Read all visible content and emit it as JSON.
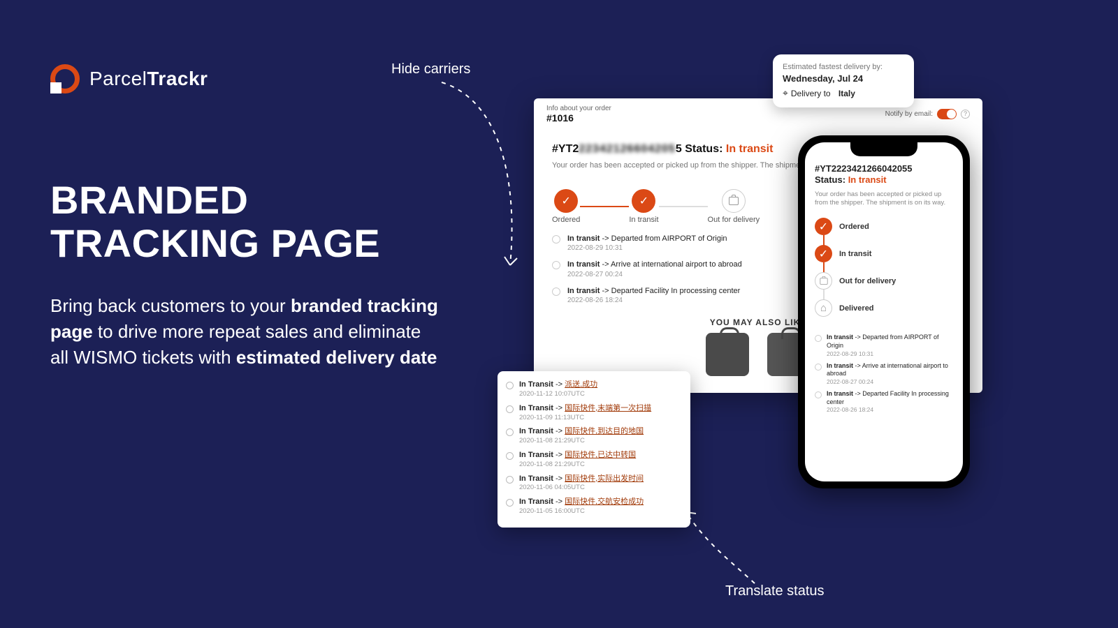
{
  "logo": {
    "name": "ParcelTrackr"
  },
  "headline": {
    "line1": "BRANDED",
    "line2": "TRACKING PAGE"
  },
  "sub": {
    "p1": "Bring back customers to your",
    "b1": "branded tracking page",
    "p2": "to drive more repeat sales and eliminate all WISMO tickets with",
    "b2": "estimated delivery date"
  },
  "annotations": {
    "hide": "Hide carriers",
    "translate": "Translate status"
  },
  "est": {
    "label": "Estimated fastest delivery by:",
    "date": "Wednesday, Jul 24",
    "deliv_prefix": "Delivery to",
    "deliv_country": "Italy"
  },
  "browser": {
    "info_label": "Info about your order",
    "order_no": "#1016",
    "notify_label": "Notify by email:",
    "tracking_prefix": "#YT2",
    "tracking_blur": "22342126604205",
    "tracking_suffix": "5",
    "status_label": "Status:",
    "status_value": "In transit",
    "sub_status": "Your order has been accepted or picked up from the shipper. The shipment is on its way.",
    "steps": [
      "Ordered",
      "In transit",
      "Out for delivery"
    ],
    "events": [
      {
        "status": "In transit",
        "desc": "Departed from AIRPORT of Origin",
        "date": "2022-08-29 10:31"
      },
      {
        "status": "In transit",
        "desc": "Arrive at international airport to abroad",
        "date": "2022-08-27 00:24"
      },
      {
        "status": "In transit",
        "desc": "Departed Facility In processing center",
        "date": "2022-08-26 18:24"
      }
    ],
    "like_heading": "YOU MAY ALSO LIKE"
  },
  "inset": {
    "events": [
      {
        "s": "In Transit",
        "cn": "派送,成功",
        "d": "2020-11-12 10:07UTC"
      },
      {
        "s": "In Transit",
        "cn": "国际快件,末端第一次扫描",
        "d": "2020-11-09 11:13UTC"
      },
      {
        "s": "In Transit",
        "cn": "国际快件,到达目的地国",
        "d": "2020-11-08 21:29UTC"
      },
      {
        "s": "In Transit",
        "cn": "国际快件,已达中转国",
        "d": "2020-11-08 21:29UTC"
      },
      {
        "s": "In Transit",
        "cn": "国际快件,实际出发时间",
        "d": "2020-11-06 04:05UTC"
      },
      {
        "s": "In Transit",
        "cn": "国际快件,交航安检成功",
        "d": "2020-11-05 16:00UTC"
      }
    ]
  },
  "phone": {
    "tracking": "#YT2223421266042055",
    "status_label": "Status:",
    "status_value": "In transit",
    "sub": "Your order has been accepted or picked up from the shipper. The shipment is on its way.",
    "steps": [
      "Ordered",
      "In transit",
      "Out for delivery",
      "Delivered"
    ],
    "events": [
      {
        "s": "In transit",
        "desc": "Departed from AIRPORT of Origin",
        "d": "2022-08-29 10:31"
      },
      {
        "s": "In transit",
        "desc": "Arrive at international airport to abroad",
        "d": "2022-08-27 00:24"
      },
      {
        "s": "In transit",
        "desc": "Departed Facility In processing center",
        "d": "2022-08-26 18:24"
      }
    ]
  }
}
